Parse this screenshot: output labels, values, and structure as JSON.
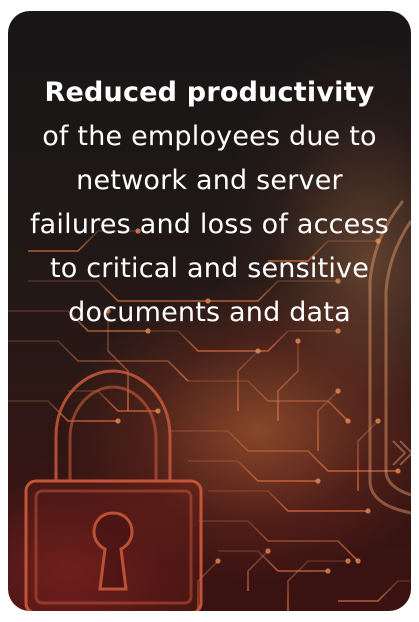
{
  "card": {
    "headline": "Reduced productivity",
    "body": "of the employees due to network and server failures and loss of access to critical and sensitive documents and data"
  },
  "colors": {
    "card_top": "#191617",
    "card_bottom": "#3a1212",
    "glow": "#d2693c",
    "circuit": "#d97a4a",
    "text": "#ffffff"
  },
  "icons": [
    "padlock-icon",
    "shield-icon",
    "circuit-board-pattern"
  ]
}
